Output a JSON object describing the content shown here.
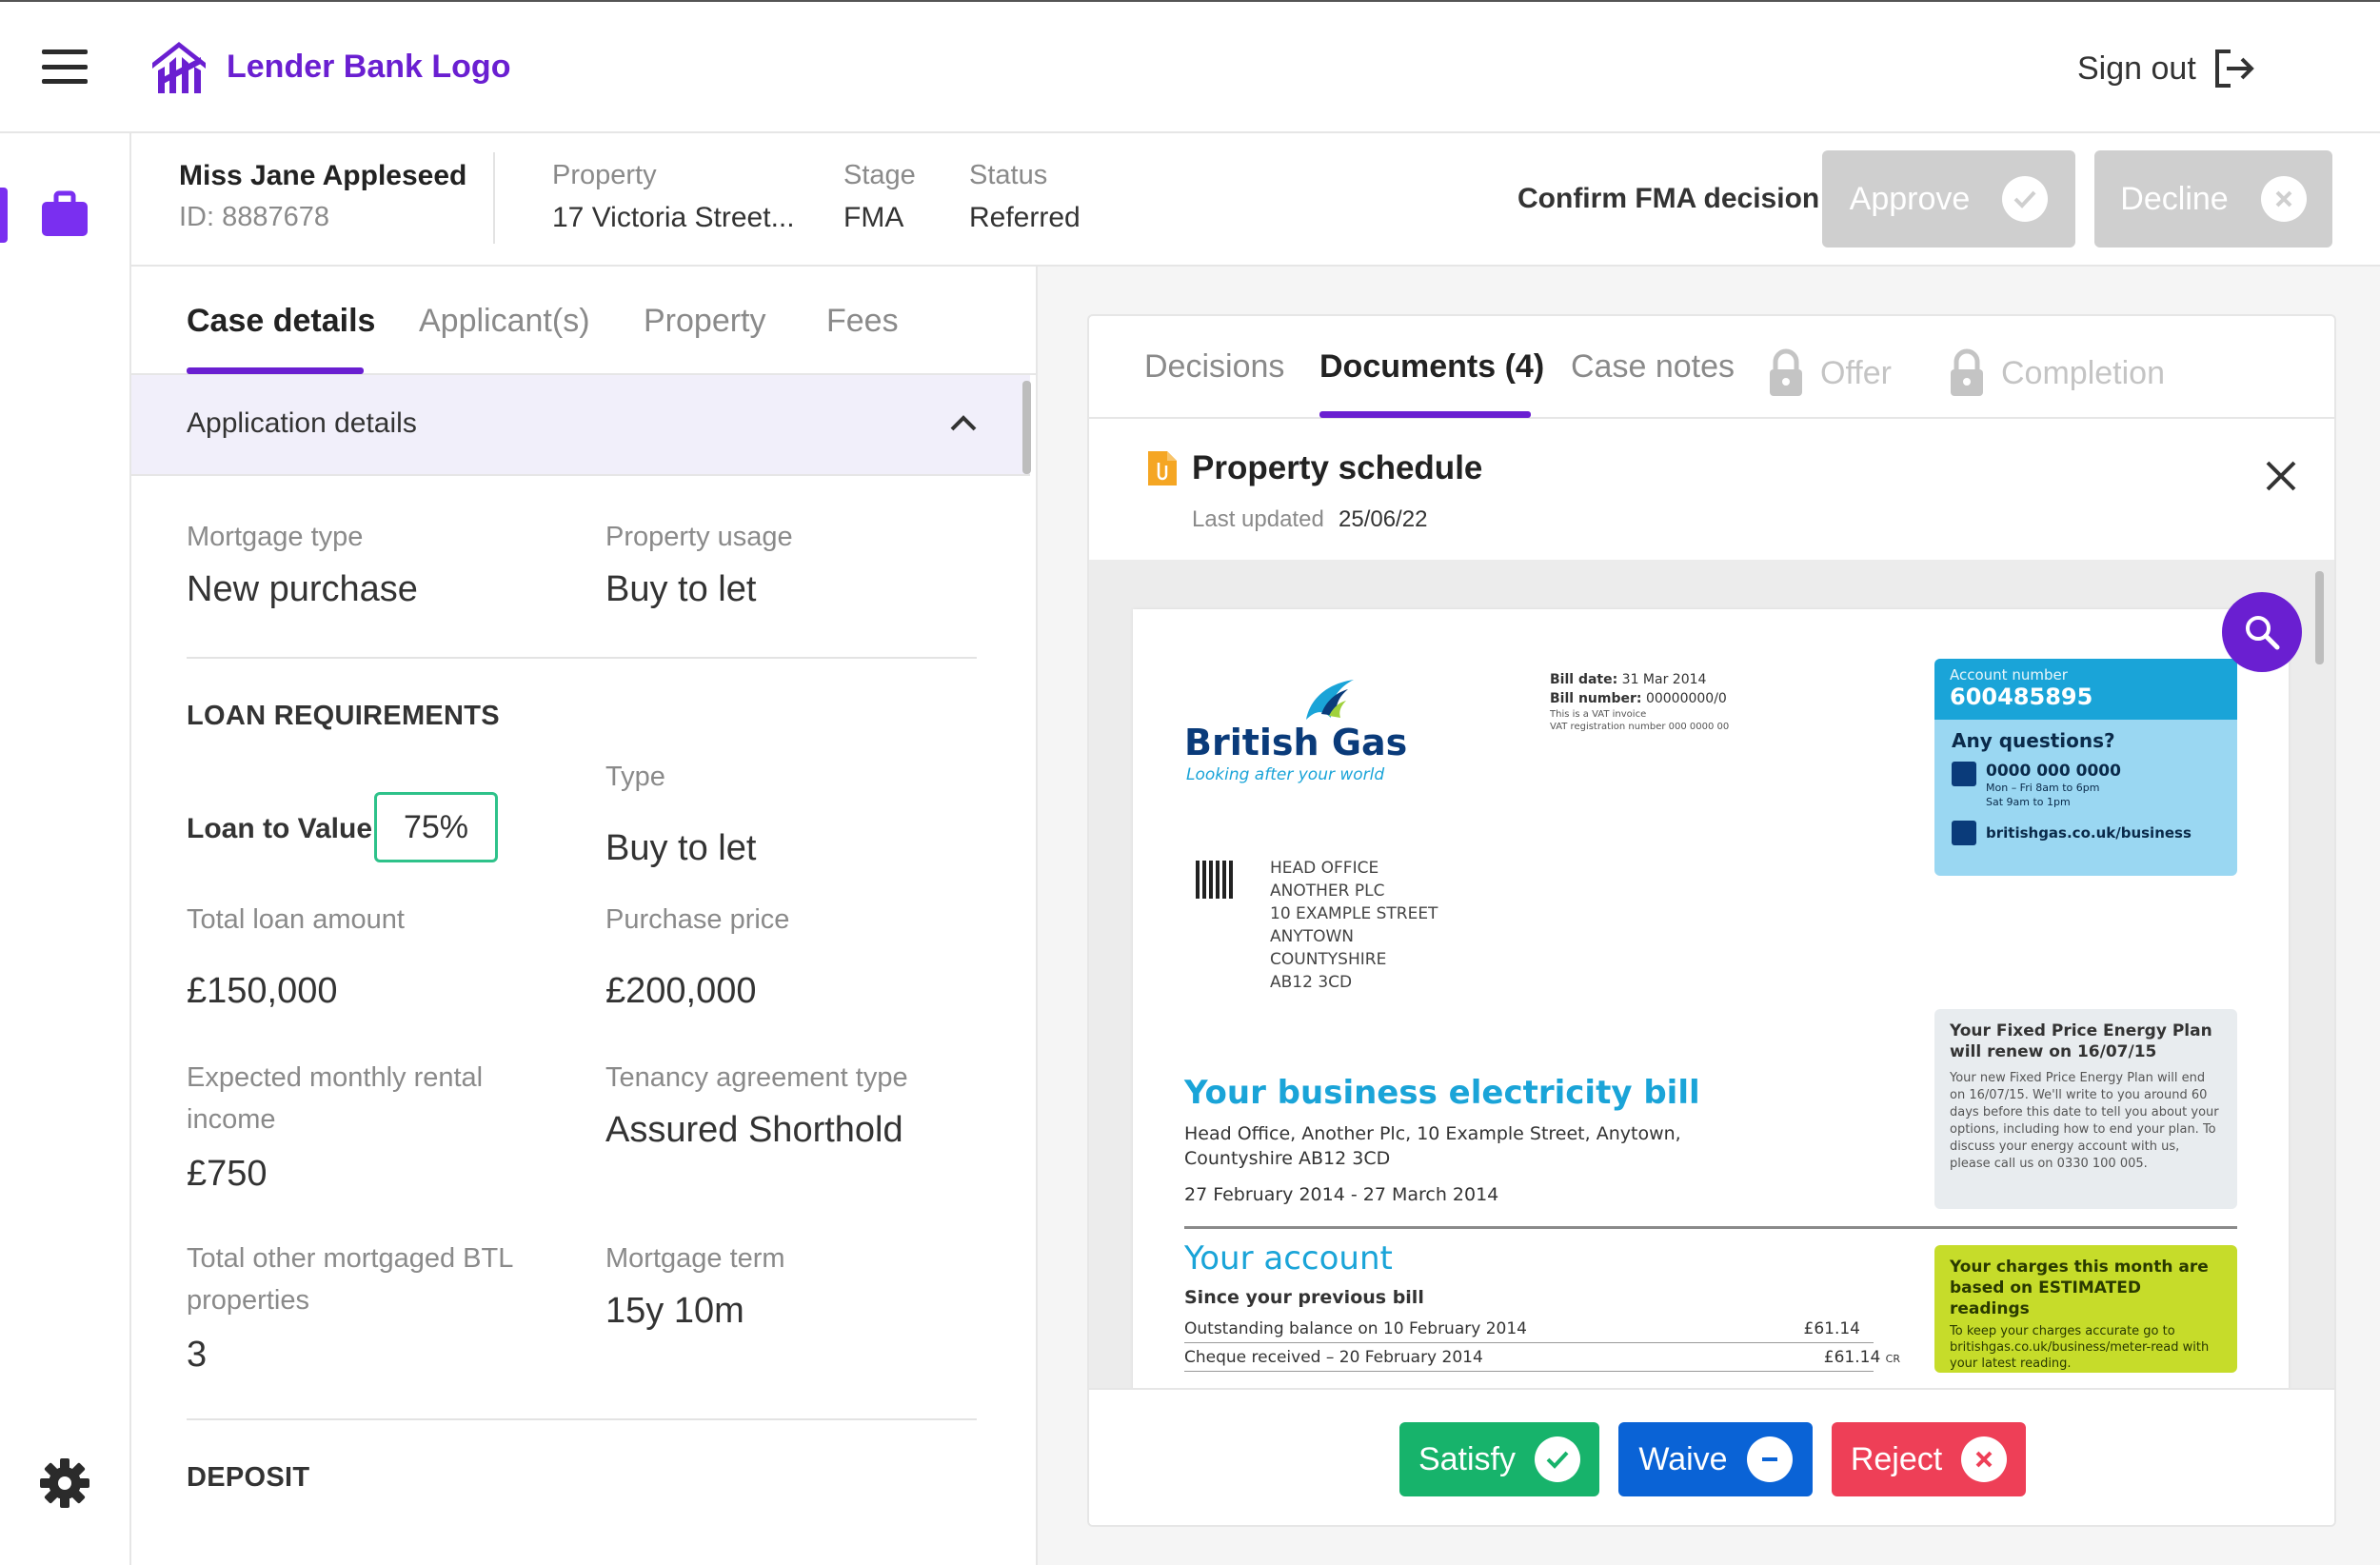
{
  "app": {
    "logo_text": "Lender Bank Logo",
    "sign_out": "Sign out",
    "accent_color": "#6a1fd1"
  },
  "case": {
    "applicant_name": "Miss Jane Appleseed",
    "applicant_id": "ID: 8887678",
    "property_label": "Property",
    "property_value": "17 Victoria Street...",
    "stage_label": "Stage",
    "stage_value": "FMA",
    "status_label": "Status",
    "status_value": "Referred",
    "confirm_label": "Confirm FMA decision",
    "approve_label": "Approve",
    "decline_label": "Decline"
  },
  "left_tabs": {
    "case_details": "Case details",
    "applicants": "Applicant(s)",
    "property": "Property",
    "fees": "Fees"
  },
  "application": {
    "section_title": "Application details",
    "mortgage_type_label": "Mortgage type",
    "mortgage_type_value": "New purchase",
    "property_usage_label": "Property usage",
    "property_usage_value": "Buy to let",
    "loan_requirements_heading": "LOAN REQUIREMENTS",
    "ltv_label": "Loan to Value",
    "ltv_value": "75%",
    "type_label": "Type",
    "type_value": "Buy to let",
    "total_loan_label": "Total loan amount",
    "total_loan_value": "£150,000",
    "purchase_price_label": "Purchase price",
    "purchase_price_value": "£200,000",
    "rental_income_label": "Expected monthly rental income",
    "rental_income_value": "£750",
    "tenancy_label": "Tenancy agreement type",
    "tenancy_value": "Assured Shorthold",
    "other_btl_label": "Total other mortgaged BTL properties",
    "other_btl_value": "3",
    "mortgage_term_label": "Mortgage term",
    "mortgage_term_value": "15y 10m",
    "deposit_heading": "DEPOSIT"
  },
  "right_tabs": {
    "decisions": "Decisions",
    "documents": "Documents (4)",
    "case_notes": "Case notes",
    "offer": "Offer",
    "completion": "Completion"
  },
  "document": {
    "title": "Property schedule",
    "last_updated_label": "Last updated",
    "last_updated_value": "25/06/22"
  },
  "bill": {
    "brand": "British Gas",
    "tagline": "Looking after your world",
    "bill_date_label": "Bill date:",
    "bill_date_value": "31 Mar 2014",
    "bill_number_label": "Bill number:",
    "bill_number_value": "00000000/0",
    "vat_invoice": "This is a VAT invoice",
    "vat_reg": "VAT registration number 000 0000 00",
    "account_number_label": "Account number",
    "account_number_value": "600485895",
    "any_questions": "Any questions?",
    "phone": "0000 000 0000",
    "hours_1": "Mon – Fri 8am to 6pm",
    "hours_2": "Sat 9am to 1pm",
    "website": "britishgas.co.uk/business",
    "address_lines": [
      "HEAD OFFICE",
      "ANOTHER PLC",
      "10 EXAMPLE STREET",
      "ANYTOWN",
      "COUNTYSHIRE",
      "AB12 3CD"
    ],
    "plan_heading": "Your Fixed Price Energy Plan will renew on 16/07/15",
    "plan_text": "Your new Fixed Price Energy Plan will end on 16/07/15. We'll write to you around 60 days before this date to tell you about your options, including how to end your plan. To discuss your energy account with us, please call us on 0330 100 005.",
    "title": "Your business electricity bill",
    "site_address_1": "Head Office, Another Plc, 10 Example Street, Anytown,",
    "site_address_2": "Countyshire AB12 3CD",
    "period": "27 February 2014 - 27 March 2014",
    "your_account": "Your account",
    "since_previous": "Since your previous bill",
    "row1_label": "Outstanding balance on 10 February 2014",
    "row1_amount": "£61.14",
    "row2_label": "Cheque received – 20 February 2014",
    "row2_amount": "£61.14",
    "row2_suffix": "CR",
    "charges_heading": "Your charges this month are based on ESTIMATED readings",
    "charges_text": "To keep your charges accurate go to britishgas.co.uk/business/meter-read with your latest reading."
  },
  "doc_actions": {
    "satisfy": "Satisfy",
    "waive": "Waive",
    "reject": "Reject",
    "satisfy_color": "#17b36b",
    "waive_color": "#0a63d6",
    "reject_color": "#ee3f57"
  }
}
